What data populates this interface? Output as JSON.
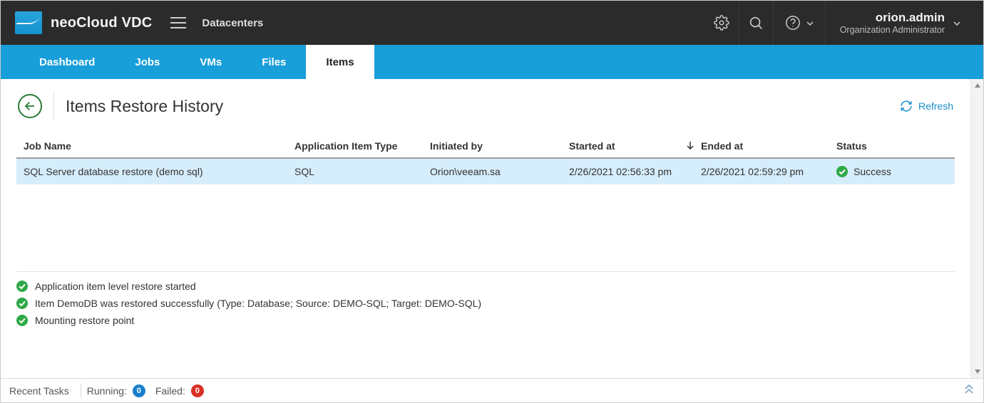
{
  "app": {
    "name": "neoCloud VDC",
    "datacenters_label": "Datacenters"
  },
  "user": {
    "name": "orion.admin",
    "role": "Organization Administrator"
  },
  "tabs": [
    {
      "label": "Dashboard"
    },
    {
      "label": "Jobs"
    },
    {
      "label": "VMs"
    },
    {
      "label": "Files"
    },
    {
      "label": "Items",
      "active": true
    }
  ],
  "page": {
    "title": "Items Restore History",
    "refresh_label": "Refresh"
  },
  "columns": {
    "job": "Job Name",
    "type": "Application Item Type",
    "initiated": "Initiated by",
    "started": "Started at",
    "ended": "Ended at",
    "status": "Status"
  },
  "rows": [
    {
      "job": "SQL Server database restore (demo sql)",
      "type": "SQL",
      "initiated": "Orion\\veeam.sa",
      "started": "2/26/2021 02:56:33 pm",
      "ended": "2/26/2021 02:59:29 pm",
      "status": "Success"
    }
  ],
  "log": [
    {
      "text": "Application item level restore started"
    },
    {
      "text": "Item DemoDB was restored successfully (Type: Database; Source: DEMO-SQL; Target: DEMO-SQL)"
    },
    {
      "text": "Mounting restore point"
    }
  ],
  "bottombar": {
    "label": "Recent Tasks",
    "running_label": "Running:",
    "running_count": "0",
    "failed_label": "Failed:",
    "failed_count": "0"
  }
}
